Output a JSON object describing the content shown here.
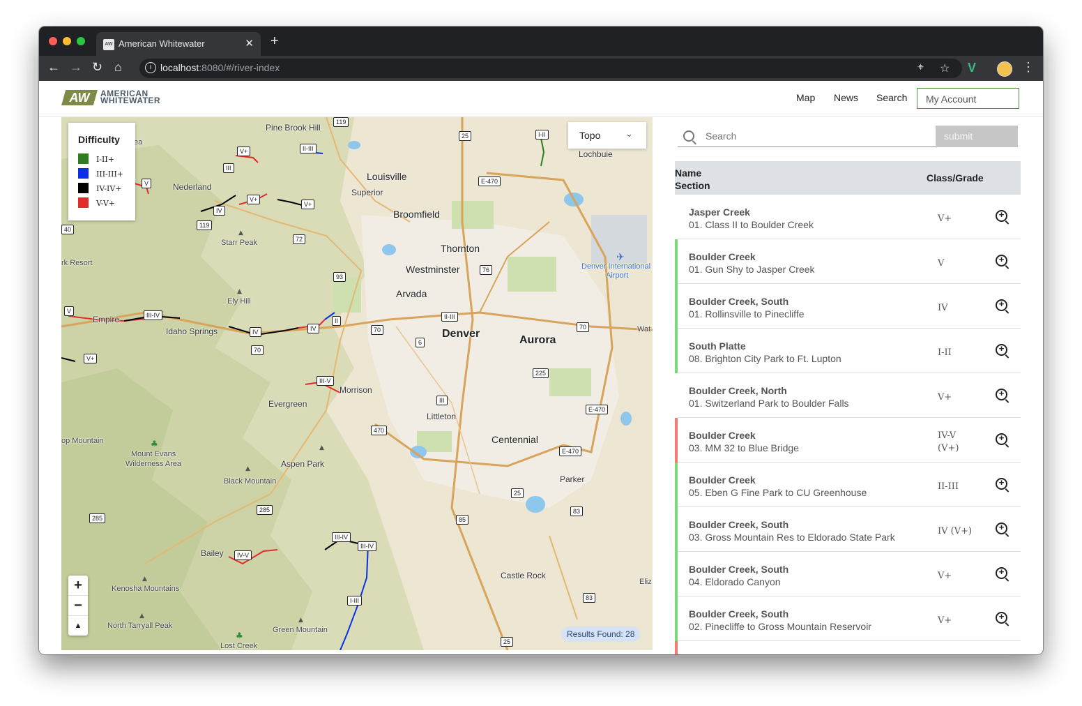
{
  "browser": {
    "tab_title": "American Whitewater",
    "url_host": "localhost",
    "url_path": ":8080/#/river-index"
  },
  "header": {
    "logo_mark": "AW",
    "logo_line1": "AMERICAN",
    "logo_line2": "WHITEWATER",
    "nav": [
      "Map",
      "News",
      "Search"
    ],
    "account_label": "My Account"
  },
  "map": {
    "legend_title": "Difficulty",
    "legend": [
      {
        "label": "I-II+",
        "color": "#2e7d1f"
      },
      {
        "label": "III-III+",
        "color": "#0a2eea"
      },
      {
        "label": "IV-IV+",
        "color": "#000000"
      },
      {
        "label": "V-V+",
        "color": "#e22b2b"
      }
    ],
    "basemap_select": "Topo",
    "results_found": "Results Found: 28",
    "zoom_in": "+",
    "zoom_out": "−",
    "compass": "▲",
    "places": {
      "denver": "Denver",
      "aurora": "Aurora",
      "thornton": "Thornton",
      "westminster": "Westminster",
      "arvada": "Arvada",
      "broomfield": "Broomfield",
      "louisville": "Louisville",
      "superior": "Superior",
      "lochbuie": "Lochbuie",
      "littleton": "Littleton",
      "centennial": "Centennial",
      "parker": "Parker",
      "castle_rock": "Castle Rock",
      "evergreen": "Evergreen",
      "morrison": "Morrison",
      "idaho_springs": "Idaho Springs",
      "empire": "Empire",
      "nederland": "Nederland",
      "pine_brook_hill": "Pine Brook Hill",
      "starr_peak": "Starr Peak",
      "ely_hill": "Ely Hill",
      "aspen_park": "Aspen Park",
      "black_mountain": "Black Mountain",
      "bailey": "Bailey",
      "kenosha_mountains": "Kenosha Mountains",
      "north_tarryall_peak": "North Tarryall Peak",
      "green_mountain": "Green Mountain",
      "lost_creek": "Lost Creek",
      "mount_evans_1": "Mount Evans",
      "mount_evans_2": "Wilderness Area",
      "denver_intl_1": "Denver International",
      "denver_intl_2": "Airport",
      "rk_resort": "rk Resort",
      "op_mountain": "op Mountain",
      "wat": "Wat",
      "eliz": "Eliz",
      "ea": "ea"
    },
    "highways": {
      "i25_n": "25",
      "i25_s": "25",
      "i25_sw": "25",
      "e470_n": "E-470",
      "e470_e": "E-470",
      "e470_s": "E-470",
      "i70_w": "70",
      "i70_c": "70",
      "i70_e": "70",
      "i76": "76",
      "i225": "225",
      "r119_a": "119",
      "r119_b": "119",
      "r72": "72",
      "r93": "93",
      "r6": "6",
      "r470": "470",
      "r285_a": "285",
      "r285_b": "285",
      "r85": "85",
      "r83_a": "83",
      "r83_b": "83",
      "r40": "40"
    },
    "class_tags": {
      "t1": "V+",
      "t2": "III",
      "t3": "II-III",
      "t4": "V",
      "t5": "IV",
      "t6": "V+",
      "t7": "V+",
      "t8": "V",
      "t9": "III-IV",
      "t10": "IV",
      "t11": "IV",
      "t12": "II",
      "t13": "II-III",
      "t14": "V+",
      "t15": "III-V",
      "t16": "III",
      "t17": "III-IV",
      "t18": "III-IV",
      "t19": "IV-V",
      "t20": "I-III",
      "t21": "I-II"
    }
  },
  "search": {
    "placeholder": "Search",
    "submit_label": "submit"
  },
  "table": {
    "col_name_line1": "Name",
    "col_name_line2": "Section",
    "col_grade": "Class/Grade",
    "rows": [
      {
        "name": "Jasper Creek",
        "section": "01. Class II to Boulder Creek",
        "grade": "V+",
        "grade2": "",
        "color": "#ffffff"
      },
      {
        "name": "Boulder Creek",
        "section": "01. Gun Shy to Jasper Creek",
        "grade": "V",
        "grade2": "",
        "color": "#7dd87b"
      },
      {
        "name": "Boulder Creek, South",
        "section": "01. Rollinsville to Pinecliffe",
        "grade": "IV",
        "grade2": "",
        "color": "#7dd87b"
      },
      {
        "name": "South Platte",
        "section": "08. Brighton City Park to Ft. Lupton",
        "grade": "I-II",
        "grade2": "",
        "color": "#7dd87b"
      },
      {
        "name": "Boulder Creek, North",
        "section": "01. Switzerland Park to Boulder Falls",
        "grade": "V+",
        "grade2": "",
        "color": "#ffffff"
      },
      {
        "name": "Boulder Creek",
        "section": "03. MM 32 to Blue Bridge",
        "grade": "IV-V",
        "grade2": "(V+)",
        "color": "#f07b72"
      },
      {
        "name": "Boulder Creek",
        "section": "05. Eben G Fine Park to CU Greenhouse",
        "grade": "II-III",
        "grade2": "",
        "color": "#7dd87b"
      },
      {
        "name": "Boulder Creek, South",
        "section": "03. Gross Mountain Res to Eldorado State Park",
        "grade": "IV (V+)",
        "grade2": "",
        "color": "#7dd87b"
      },
      {
        "name": "Boulder Creek, South",
        "section": "04. Eldorado Canyon",
        "grade": "V+",
        "grade2": "",
        "color": "#7dd87b"
      },
      {
        "name": "Boulder Creek, South",
        "section": "02. Pinecliffe to Gross Mountain Reservoir",
        "grade": "V+",
        "grade2": "",
        "color": "#7dd87b"
      },
      {
        "name": "",
        "section": "",
        "grade": "",
        "grade2": "",
        "color": "#f07b72"
      }
    ]
  }
}
